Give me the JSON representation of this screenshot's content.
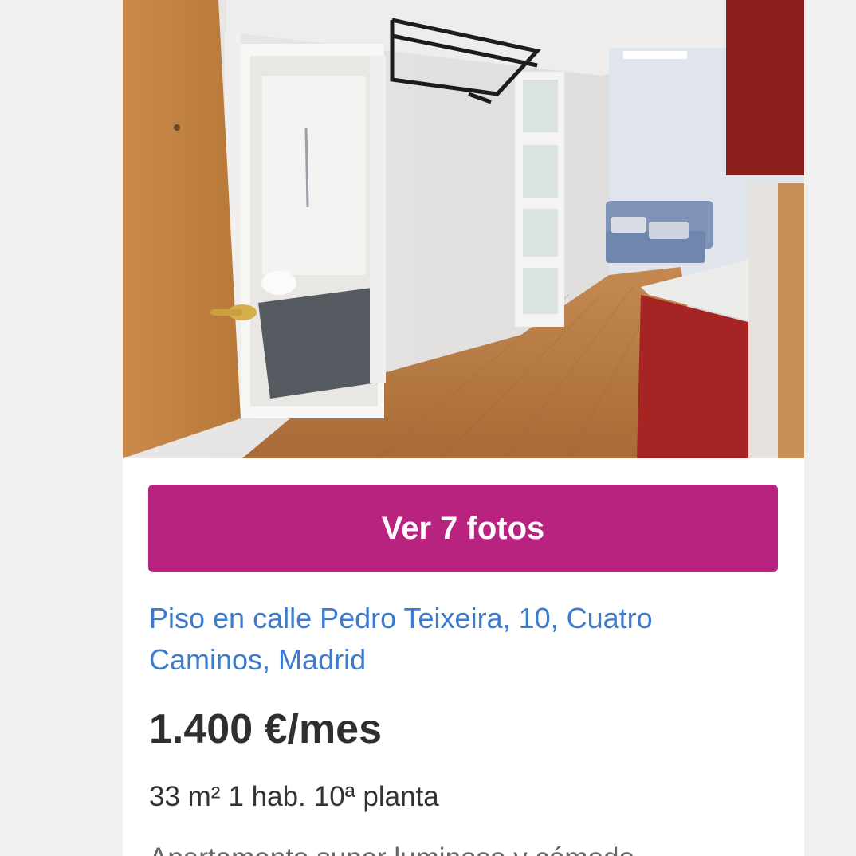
{
  "listing": {
    "photo": {
      "icon": "apartment-photo",
      "photo_count": 7
    },
    "gallery_button_label": "Ver 7 fotos",
    "title": "Piso en calle Pedro Teixeira, 10, Cuatro Caminos, Madrid",
    "price": "1.400 €/mes",
    "features": [
      "33 m²",
      "1 hab.",
      "10ª planta"
    ],
    "description_preview": "Apartamento super luminoso y cómodo"
  },
  "colors": {
    "accent": "#b8237f",
    "link": "#3b7bd0",
    "price_text": "#2f2f2f",
    "page_bg": "#f1f1f1",
    "card_bg": "#ffffff"
  }
}
